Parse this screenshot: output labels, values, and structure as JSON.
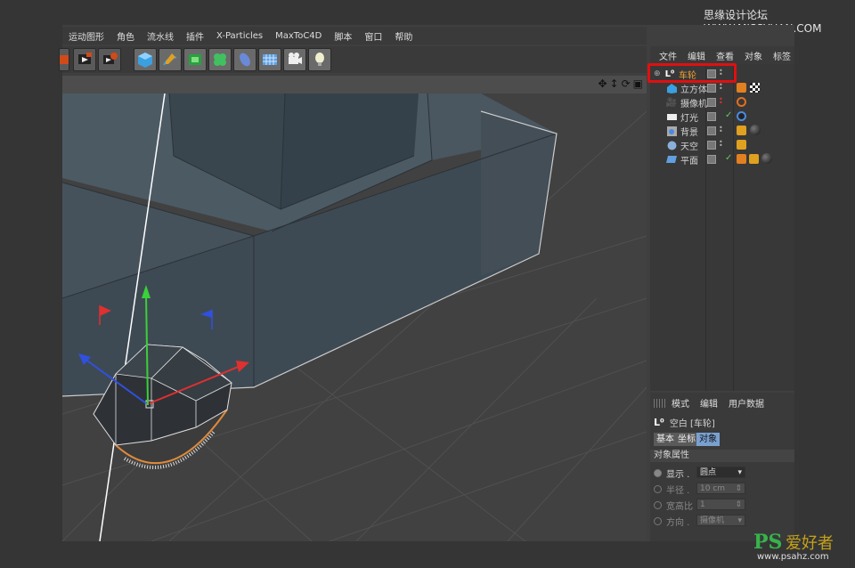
{
  "watermark_top": "思缘设计论坛 WWW.MISSYUAN.COM",
  "watermark_bottom": {
    "ps": "PS",
    "cn": "爱好者",
    "url": "www.psahz.com"
  },
  "menubar": [
    "运动图形",
    "角色",
    "流水线",
    "插件",
    "X-Particles",
    "MaxToC4D",
    "脚本",
    "窗口",
    "帮助"
  ],
  "toolbar": [
    "render-region-icon",
    "render-view-icon",
    "render-settings-icon",
    "cube-icon",
    "pen-icon",
    "subdivision-icon",
    "array-icon",
    "deformer-icon",
    "floor-icon",
    "camera-icon",
    "light-icon"
  ],
  "viewport_icons": [
    "move-view-icon",
    "zoom-view-icon",
    "rotate-view-icon",
    "maximize-view-icon"
  ],
  "object_manager": {
    "menu": [
      "文件",
      "编辑",
      "查看",
      "对象",
      "标签"
    ],
    "objects": [
      {
        "name": "车轮",
        "icon": "null-icon",
        "selected": true
      },
      {
        "name": "立方体",
        "icon": "cube-icon",
        "tags": [
          "phong-tag-icon",
          "checker-material-icon"
        ]
      },
      {
        "name": "摄像机",
        "icon": "camera-icon",
        "tags": [
          "target-tag-icon"
        ]
      },
      {
        "name": "灯光",
        "icon": "light-icon",
        "tags": [
          "light-target-icon"
        ]
      },
      {
        "name": "背景",
        "icon": "background-icon",
        "tags": [
          "texture-tag-icon",
          "material-sphere-icon"
        ]
      },
      {
        "name": "天空",
        "icon": "sky-icon",
        "tags": [
          "texture-tag-icon"
        ]
      },
      {
        "name": "平面",
        "icon": "plane-icon",
        "tags": [
          "phong-tag-icon",
          "texture-tag-icon",
          "material-sphere-icon"
        ]
      }
    ]
  },
  "attribute_manager": {
    "menu": [
      "模式",
      "编辑",
      "用户数据"
    ],
    "title": "空白 [车轮]",
    "tabs": [
      "基本",
      "坐标",
      "对象"
    ],
    "active_tab": "对象",
    "section": "对象属性",
    "fields": [
      {
        "label": "显示 .",
        "value": "圆点",
        "enabled": true
      },
      {
        "label": "半径 .",
        "value": "10 cm",
        "enabled": false
      },
      {
        "label": "宽高比",
        "value": "1",
        "enabled": false
      },
      {
        "label": "方向 .",
        "value": "摄像机",
        "enabled": false
      }
    ]
  }
}
